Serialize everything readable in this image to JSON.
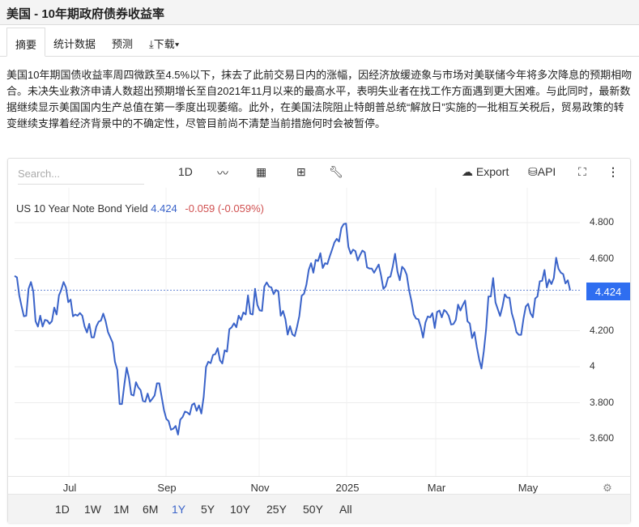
{
  "title": "美国 - 10年期政府债券收益率",
  "tabs": [
    {
      "label": "摘要"
    },
    {
      "label": "统计数据"
    },
    {
      "label": "预测"
    },
    {
      "label": "下载"
    }
  ],
  "summary": "美国10年期国债收益率周四微跌至4.5%以下，抹去了此前交易日内的涨幅，因经济放缓迹象与市场对美联储今年将多次降息的预期相吻合。未决失业救济申请人数超出预期增长至自2021年11月以来的最高水平，表明失业者在找工作方面遇到更大困难。与此同时，最新数据继续显示美国国内生产总值在第一季度出现萎缩。此外，在美国法院阻止特朗普总统“解放日”实施的一批相互关税后，贸易政策的转变继续支撑着经济背景中的不确定性，尽管目前尚不清楚当前措施何时会被暂停。",
  "toolbar": {
    "search_placeholder": "Search...",
    "interval": "1D",
    "export": "Export",
    "api": "API"
  },
  "legend": {
    "name": "US 10 Year Note Bond Yield",
    "value": "4.424",
    "change": "-0.059 (-0.059%)"
  },
  "current_badge": "4.424",
  "ranges": [
    "1D",
    "1W",
    "1M",
    "6M",
    "1Y",
    "5Y",
    "10Y",
    "25Y",
    "50Y",
    "All"
  ],
  "selected_range": "1Y",
  "colors": {
    "line": "#3a63c9",
    "badge": "#2f6ef0",
    "negative": "#d05050"
  },
  "chart_data": {
    "type": "line",
    "title": "US 10 Year Note Bond Yield",
    "ylim": [
      3.5,
      4.95
    ],
    "yticks": [
      "4.800",
      "4.600",
      "4.200",
      "4",
      "3.800",
      "3.600"
    ],
    "ytick_values": [
      4.8,
      4.6,
      4.2,
      4.0,
      3.8,
      3.6
    ],
    "xticks": [
      "Jul",
      "Sep",
      "Nov",
      "2025",
      "Mar",
      "May"
    ],
    "current": 4.424,
    "values": [
      4.504,
      4.496,
      4.396,
      4.336,
      4.28,
      4.283,
      4.433,
      4.47,
      4.418,
      4.253,
      4.223,
      4.283,
      4.223,
      4.26,
      4.256,
      4.238,
      4.253,
      4.328,
      4.29,
      4.396,
      4.426,
      4.47,
      4.44,
      4.358,
      4.373,
      4.28,
      4.29,
      4.283,
      4.298,
      4.283,
      4.223,
      4.19,
      4.238,
      4.163,
      4.163,
      4.223,
      4.25,
      4.256,
      4.295,
      4.253,
      4.193,
      4.163,
      4.133,
      4.028,
      3.983,
      3.793,
      3.793,
      3.9,
      3.995,
      3.938,
      3.845,
      3.84,
      3.914,
      3.885,
      3.87,
      3.81,
      3.806,
      3.851,
      3.806,
      3.822,
      3.84,
      3.908,
      3.908,
      3.833,
      3.758,
      3.71,
      3.698,
      3.65,
      3.656,
      3.671,
      3.623,
      3.706,
      3.721,
      3.751,
      3.746,
      3.734,
      3.788,
      3.797,
      3.755,
      3.785,
      3.74,
      3.833,
      3.998,
      4.028,
      4.02,
      4.065,
      4.07,
      4.103,
      4.036,
      4.018,
      4.091,
      4.084,
      4.208,
      4.219,
      4.241,
      4.219,
      4.283,
      4.26,
      4.301,
      4.29,
      4.396,
      4.294,
      4.29,
      4.433,
      4.343,
      4.313,
      4.31,
      4.445,
      4.468,
      4.445,
      4.44,
      4.403,
      4.426,
      4.418,
      4.283,
      4.309,
      4.264,
      4.178,
      4.225,
      4.18,
      4.17,
      4.222,
      4.282,
      4.394,
      4.405,
      4.455,
      4.537,
      4.575,
      4.522,
      4.593,
      4.587,
      4.63,
      4.548,
      4.575,
      4.57,
      4.612,
      4.65,
      4.69,
      4.71,
      4.695,
      4.77,
      4.792,
      4.795,
      4.665,
      4.627,
      4.65,
      4.642,
      4.59,
      4.62,
      4.645,
      4.635,
      4.552,
      4.545,
      4.545,
      4.522,
      4.545,
      4.567,
      4.507,
      4.432,
      4.447,
      4.495,
      4.5,
      4.555,
      4.627,
      4.53,
      4.48,
      4.555,
      4.54,
      4.51,
      4.425,
      4.365,
      4.29,
      4.267,
      4.264,
      4.222,
      4.162,
      4.245,
      4.279,
      4.274,
      4.297,
      4.215,
      4.304,
      4.312,
      4.274,
      4.315,
      4.304,
      4.282,
      4.234,
      4.237,
      4.26,
      4.345,
      4.312,
      4.342,
      4.367,
      4.252,
      4.24,
      4.159,
      4.192,
      4.11,
      4.042,
      3.99,
      4.087,
      4.207,
      4.39,
      4.39,
      4.492,
      4.357,
      4.32,
      4.282,
      4.334,
      4.402,
      4.384,
      4.384,
      4.297,
      4.252,
      4.192,
      4.177,
      4.177,
      4.267,
      4.334,
      4.349,
      4.297,
      4.274,
      4.379,
      4.39,
      4.474,
      4.477,
      4.537,
      4.44,
      4.484,
      4.459,
      4.492,
      4.605,
      4.544,
      4.522,
      4.514,
      4.462,
      4.48,
      4.424
    ]
  }
}
